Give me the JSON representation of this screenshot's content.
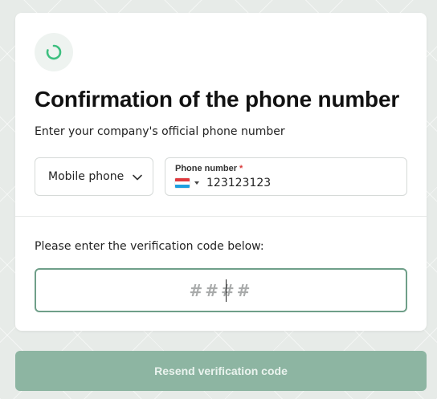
{
  "header": {
    "icon": "loading-spinner-icon",
    "title": "Confirmation of the phone number",
    "subtitle": "Enter your company's official phone number"
  },
  "phone_type_select": {
    "value": "Mobile phone",
    "icon": "chevron-down-icon"
  },
  "phone_field": {
    "label": "Phone number",
    "required_mark": "*",
    "country_flag": "netherlands-flag-icon",
    "value": "123123123"
  },
  "verification": {
    "label": "Please enter the verification code below:",
    "placeholder": "####"
  },
  "resend_button": {
    "label": "Resend verification code"
  },
  "colors": {
    "accent": "#3dbf7f",
    "input_focus_border": "#6f9f89",
    "button_bg": "#8db5a2",
    "required": "#d93a3a"
  }
}
